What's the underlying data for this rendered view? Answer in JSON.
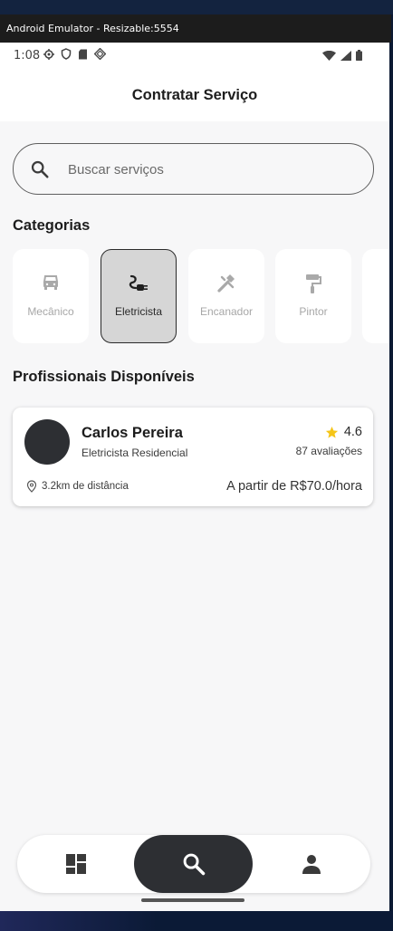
{
  "window": {
    "title": "Android Emulator - Resizable:5554"
  },
  "statusbar": {
    "time": "1:08",
    "left_icons": [
      "gear-icon",
      "shield-icon",
      "sd-card-icon",
      "play-protect-icon"
    ],
    "right_icons": [
      "wifi-icon",
      "signal-icon",
      "battery-icon"
    ]
  },
  "appbar": {
    "title": "Contratar Serviço"
  },
  "search": {
    "placeholder": "Buscar serviços",
    "value": ""
  },
  "categories": {
    "title": "Categorias",
    "items": [
      {
        "label": "Mecânico",
        "icon": "car-icon",
        "selected": false
      },
      {
        "label": "Eletricista",
        "icon": "electrical-plug-icon",
        "selected": true
      },
      {
        "label": "Encanador",
        "icon": "plumbing-icon",
        "selected": false
      },
      {
        "label": "Pintor",
        "icon": "paint-roller-icon",
        "selected": false
      }
    ]
  },
  "professionals": {
    "title": "Profissionais Disponíveis",
    "items": [
      {
        "name": "Carlos Pereira",
        "role": "Eletricista Residencial",
        "rating": "4.6",
        "reviews": "87 avaliações",
        "distance": "3.2km de distância",
        "price": "A partir de R$70.0/hora"
      }
    ]
  },
  "bottom_nav": {
    "items": [
      {
        "icon": "dashboard-icon",
        "active": false
      },
      {
        "icon": "search-icon",
        "active": true
      },
      {
        "icon": "person-icon",
        "active": false
      }
    ]
  },
  "colors": {
    "background": "#f7f7f8",
    "surface": "#ffffff",
    "accent_dark": "#2d2f33",
    "star": "#f5c518",
    "selected_category_bg": "#d6d6d6"
  }
}
